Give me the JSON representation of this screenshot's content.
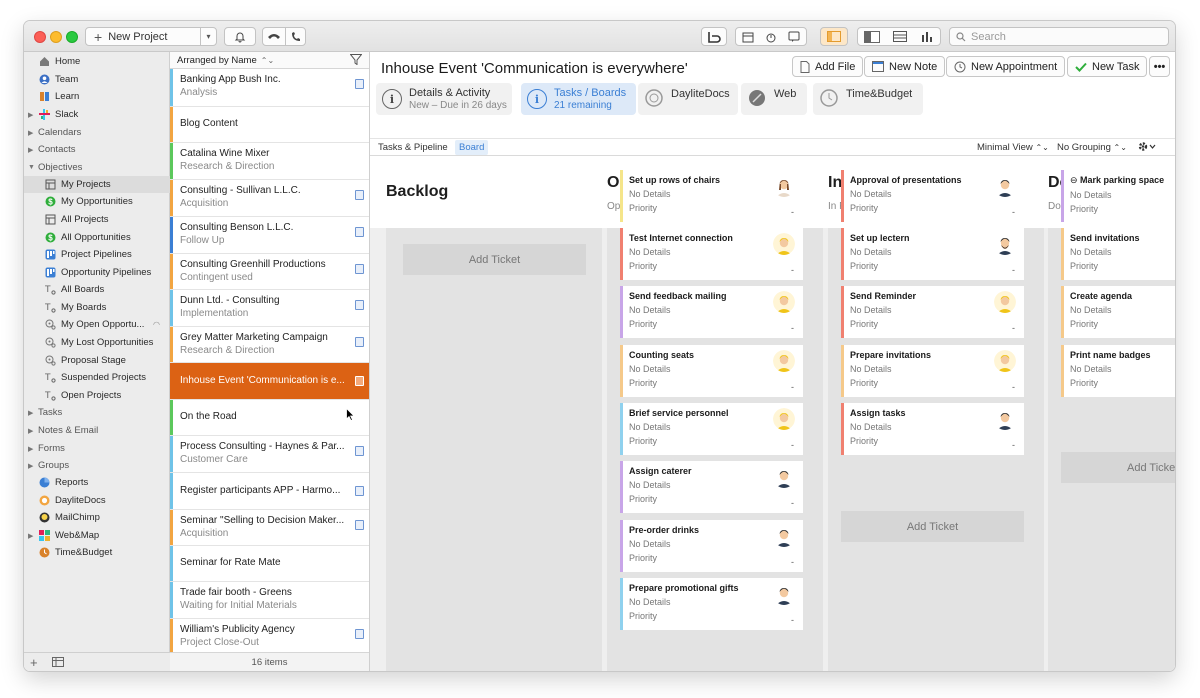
{
  "toolbar": {
    "new_project": "New Project",
    "search_placeholder": "Search"
  },
  "sidebar": {
    "items": [
      {
        "label": "Home",
        "icon": "home-icon"
      },
      {
        "label": "Team",
        "icon": "team-icon"
      },
      {
        "label": "Learn",
        "icon": "learn-icon"
      },
      {
        "label": "Slack",
        "icon": "slack-icon"
      },
      {
        "label": "Calendars",
        "section": true
      },
      {
        "label": "Contacts",
        "section": true
      },
      {
        "label": "Objectives",
        "section": true
      },
      {
        "label": "My Projects",
        "icon": "projects-icon"
      },
      {
        "label": "My Opportunities",
        "icon": "dollar-icon"
      },
      {
        "label": "All Projects",
        "icon": "projects-icon"
      },
      {
        "label": "All Opportunities",
        "icon": "dollar-icon"
      },
      {
        "label": "Project Pipelines",
        "icon": "pipeline-icon"
      },
      {
        "label": "Opportunity Pipelines",
        "icon": "pipeline-icon"
      },
      {
        "label": "All Boards",
        "icon": "board-icon"
      },
      {
        "label": "My Boards",
        "icon": "board-icon"
      },
      {
        "label": "My Open Opportu...",
        "icon": "smart-icon"
      },
      {
        "label": "My Lost Opportunities",
        "icon": "smart-icon"
      },
      {
        "label": "Proposal Stage",
        "icon": "smart-icon"
      },
      {
        "label": "Suspended Projects",
        "icon": "board-icon"
      },
      {
        "label": "Open Projects",
        "icon": "board-icon"
      },
      {
        "label": "Tasks",
        "section": true
      },
      {
        "label": "Notes & Email",
        "section": true
      },
      {
        "label": "Forms",
        "section": true
      },
      {
        "label": "Groups",
        "section": true
      },
      {
        "label": "Reports",
        "icon": "reports-icon"
      },
      {
        "label": "DayliteDocs",
        "icon": "daylitedocs-icon"
      },
      {
        "label": "MailChimp",
        "icon": "mailchimp-icon"
      },
      {
        "label": "Web&Map",
        "icon": "webmap-icon"
      },
      {
        "label": "Time&Budget",
        "icon": "timebudget-icon"
      }
    ]
  },
  "list": {
    "sort_label": "Arranged by Name",
    "footer": "16 items",
    "rows": [
      {
        "title": "Banking App Bush Inc.",
        "subtitle": "Analysis",
        "color": "#6fc3e8"
      },
      {
        "title": "Blog Content",
        "subtitle": "",
        "color": "#f2a541"
      },
      {
        "title": "Catalina Wine Mixer",
        "subtitle": "Research & Direction",
        "color": "#5cc85c"
      },
      {
        "title": "Consulting - Sullivan L.L.C.",
        "subtitle": "Acquisition",
        "color": "#f2a541"
      },
      {
        "title": "Consulting Benson L.L.C.",
        "subtitle": "Follow Up",
        "color": "#3b7fd4"
      },
      {
        "title": "Consulting Greenhill Productions",
        "subtitle": "Contingent used",
        "color": "#f2a541"
      },
      {
        "title": "Dunn Ltd. - Consulting",
        "subtitle": "Implementation",
        "color": "#6fc3e8"
      },
      {
        "title": "Grey Matter Marketing Campaign",
        "subtitle": "Research & Direction",
        "color": "#f2a541"
      },
      {
        "title": "Inhouse Event 'Communication is e...",
        "subtitle": "",
        "color": "#dc6214"
      },
      {
        "title": "On the Road",
        "subtitle": "",
        "color": "#5cc85c"
      },
      {
        "title": "Process Consulting - Haynes & Par...",
        "subtitle": "Customer Care",
        "color": "#6fc3e8"
      },
      {
        "title": "Register participants APP - Harmo...",
        "subtitle": "",
        "color": "#6fc3e8"
      },
      {
        "title": "Seminar \"Selling to Decision Maker...",
        "subtitle": "Acquisition",
        "color": "#f2a541"
      },
      {
        "title": "Seminar for Rate Mate",
        "subtitle": "",
        "color": "#6fc3e8"
      },
      {
        "title": "Trade fair booth - Greens",
        "subtitle": "Waiting for Initial Materials",
        "color": "#6fc3e8"
      },
      {
        "title": "William's Publicity Agency",
        "subtitle": "Project Close-Out",
        "color": "#f2a541"
      }
    ]
  },
  "main": {
    "title": "Inhouse Event 'Communication is everywhere'",
    "actions": {
      "add_file": "Add File",
      "new_note": "New Note",
      "new_appointment": "New Appointment",
      "new_task": "New Task"
    },
    "tabs": [
      {
        "label": "Details & Activity",
        "sub": "New – Due in 26 days"
      },
      {
        "label": "Tasks / Boards",
        "sub": "21 remaining"
      },
      {
        "label": "DayliteDocs",
        "sub": ""
      },
      {
        "label": "Web",
        "sub": ""
      },
      {
        "label": "Time&Budget",
        "sub": ""
      }
    ],
    "subtabs": {
      "tasks_pipeline": "Tasks & Pipeline",
      "board": "Board",
      "view": "Minimal View",
      "grouping": "No Grouping"
    }
  },
  "board": {
    "add_ticket": "Add Ticket",
    "columns": [
      {
        "title": "Backlog",
        "sub": ""
      },
      {
        "title": "Open",
        "sub": "Open"
      },
      {
        "title": "In Progress",
        "sub": "In Progress"
      },
      {
        "title": "Done",
        "sub": "Done"
      }
    ],
    "card_details": "No Details",
    "card_priority": "Priority",
    "card_dash": "-",
    "open_cards": [
      {
        "title": "Set up rows of chairs",
        "color": "#f5e58a",
        "avatar": "female"
      },
      {
        "title": "Test Internet connection",
        "color": "#f08070",
        "avatar": "blond"
      },
      {
        "title": "Send feedback mailing",
        "color": "#c8a5e8",
        "avatar": "blond"
      },
      {
        "title": "Counting seats",
        "color": "#f5c98a",
        "avatar": "blond"
      },
      {
        "title": "Brief service personnel",
        "color": "#8fd1ee",
        "avatar": "blond"
      },
      {
        "title": "Assign caterer",
        "color": "#c8a5e8",
        "avatar": "dark"
      },
      {
        "title": "Pre-order drinks",
        "color": "#c8a5e8",
        "avatar": "dark"
      },
      {
        "title": "Prepare promotional gifts",
        "color": "#8fd1ee",
        "avatar": "dark"
      }
    ],
    "progress_cards": [
      {
        "title": "Approval of presentations",
        "color": "#f08070",
        "avatar": "dark"
      },
      {
        "title": "Set up lectern",
        "color": "#f08070",
        "avatar": "beard"
      },
      {
        "title": "Send Reminder",
        "color": "#f08070",
        "avatar": "blond"
      },
      {
        "title": "Prepare invitations",
        "color": "#f5c98a",
        "avatar": "blond"
      },
      {
        "title": "Assign tasks",
        "color": "#f08070",
        "avatar": "dark"
      }
    ],
    "done_cards": [
      {
        "title": "Mark parking space",
        "color": "#c8a5e8"
      },
      {
        "title": "Send invitations",
        "color": "#f5c98a"
      },
      {
        "title": "Create agenda",
        "color": "#f5c98a"
      },
      {
        "title": "Print name badges",
        "color": "#f5c98a"
      }
    ]
  }
}
